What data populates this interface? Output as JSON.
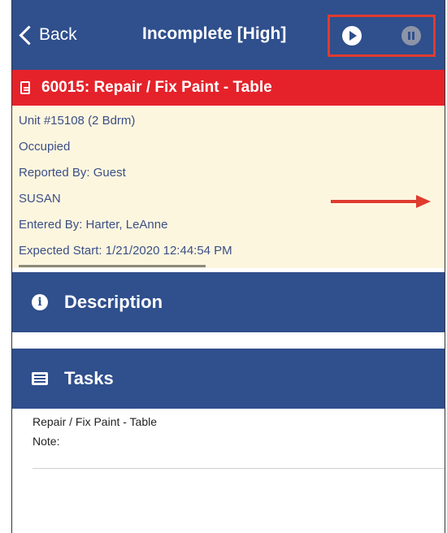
{
  "navbar": {
    "back_label": "Back",
    "title": "Incomplete [High]",
    "play_icon": "play-circle-icon",
    "pause_icon": "pause-circle-icon"
  },
  "workorder": {
    "heading": "60015: Repair / Fix Paint - Table",
    "icon": "document-icon"
  },
  "details": {
    "unit": "Unit #15108 (2 Bdrm)",
    "occupancy": "Occupied",
    "reported_by": "Reported By: Guest",
    "reporter_name": "SUSAN",
    "entered_by": "Entered By: Harter, LeAnne",
    "expected_start": "Expected Start: 1/21/2020 12:44:54 PM"
  },
  "sections": {
    "description": {
      "label": "Description",
      "icon": "info-icon"
    },
    "tasks": {
      "label": "Tasks",
      "icon": "list-icon"
    }
  },
  "tasks": [
    {
      "name": "Repair / Fix Paint - Table",
      "note": "Note:"
    }
  ],
  "colors": {
    "nav_blue": "#2f4f8d",
    "banner_red": "#e5222a",
    "details_bg": "#fdf6df",
    "annotation_red": "#e03b2f"
  }
}
